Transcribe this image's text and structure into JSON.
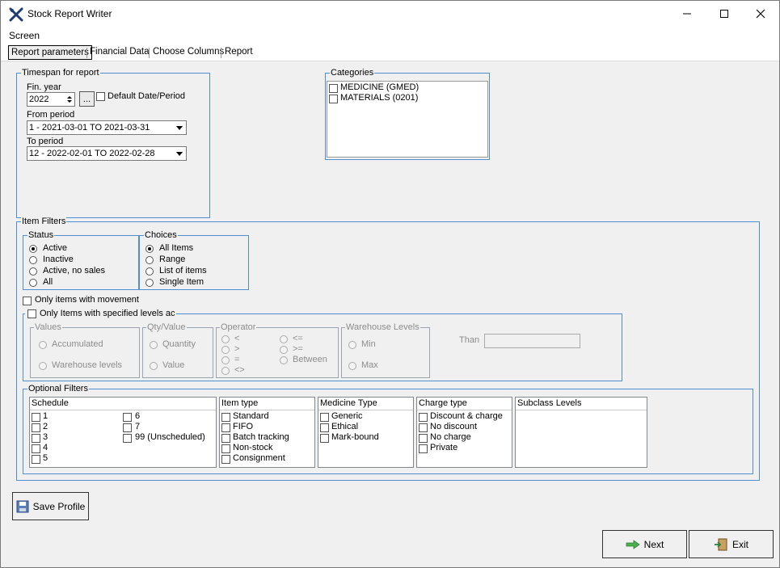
{
  "window": {
    "title": "Stock Report Writer"
  },
  "menu": {
    "items": [
      "Screen"
    ]
  },
  "tabs": [
    "Report parameters",
    "Financial Data",
    "Choose Columns",
    "Report"
  ],
  "timespan": {
    "legend": "Timespan for report",
    "fin_year_label": "Fin. year",
    "fin_year_value": "2022",
    "browse_label": "...",
    "default_label": "Default Date/Period",
    "from_label": "From period",
    "from_value": "1  - 2021-03-01 TO 2021-03-31",
    "to_label": "To period",
    "to_value": "12 - 2022-02-01 TO 2022-02-28"
  },
  "categories": {
    "legend": "Categories",
    "items": [
      "MEDICINE  (GMED)",
      "MATERIALS  (0201)"
    ]
  },
  "item_filters": {
    "legend": "Item Filters",
    "status": {
      "legend": "Status",
      "options": [
        "Active",
        "Inactive",
        "Active, no sales",
        "All"
      ],
      "selected": "Active"
    },
    "choices": {
      "legend": "Choices",
      "options": [
        "All Items",
        "Range",
        "List of items",
        "Single Item"
      ],
      "selected": "All Items"
    },
    "movement_label": "Only items with movement",
    "levels_label": "Only Items with specified levels ac",
    "values": {
      "legend": "Values",
      "options": [
        "Accumulated",
        "Warehouse levels"
      ]
    },
    "qty_value": {
      "legend": "Qty/Value",
      "options": [
        "Quantity",
        "Value"
      ]
    },
    "operator": {
      "legend": "Operator",
      "options_left": [
        "<",
        ">",
        "=",
        "<>"
      ],
      "options_right": [
        "<=",
        ">=",
        "Between"
      ]
    },
    "warehouse_levels": {
      "legend": "Warehouse Levels",
      "options": [
        "Min",
        "Max"
      ]
    },
    "than_label": "Than"
  },
  "optional_filters": {
    "legend": "Optional Filters",
    "schedule": {
      "header": "Schedule",
      "col1": [
        "1",
        "2",
        "3",
        "4",
        "5"
      ],
      "col2": [
        "6",
        "7",
        "99 (Unscheduled)"
      ]
    },
    "item_type": {
      "header": "Item type",
      "items": [
        "Standard",
        "FIFO",
        "Batch tracking",
        "Non-stock",
        "Consignment"
      ]
    },
    "medicine_type": {
      "header": "Medicine Type",
      "items": [
        "Generic",
        "Ethical",
        "Mark-bound"
      ]
    },
    "charge_type": {
      "header": "Charge type",
      "items": [
        "Discount & charge",
        "No discount",
        "No charge",
        "Private"
      ]
    },
    "subclass": {
      "header": "Subclass Levels"
    }
  },
  "buttons": {
    "save_profile": "Save Profile",
    "next": "Next",
    "exit": "Exit"
  }
}
